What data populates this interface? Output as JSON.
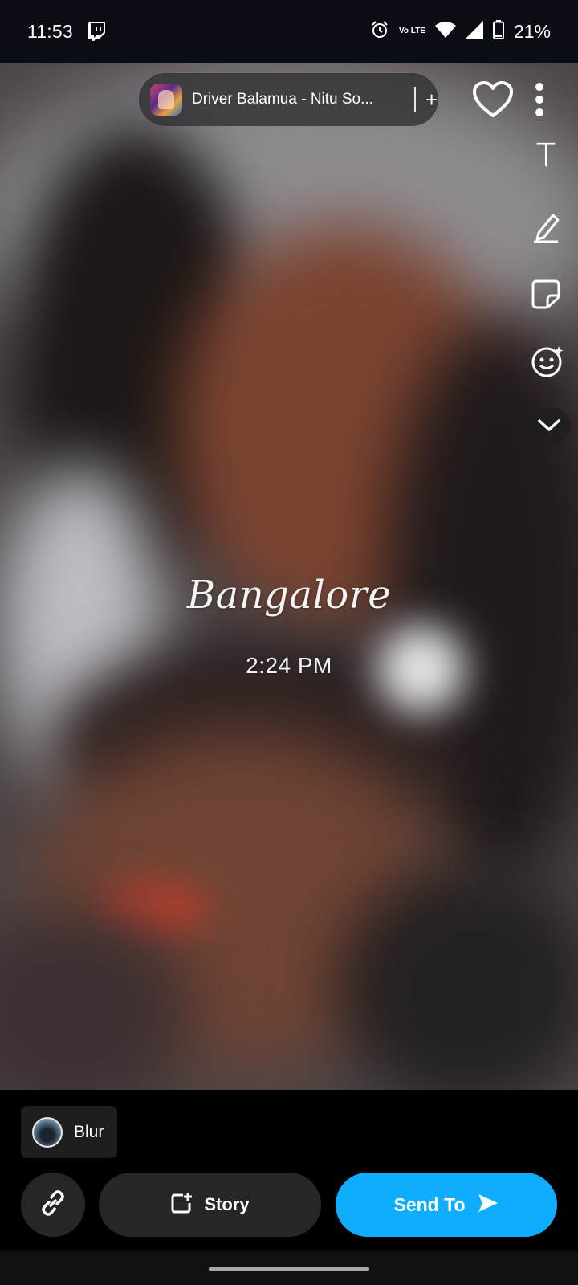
{
  "status_bar": {
    "time": "11:53",
    "network_label": "Vo LTE",
    "battery_percent": "21%"
  },
  "music": {
    "song_title": "Driver Balamua - Nitu So...",
    "add_symbol": "+"
  },
  "right_tools": {
    "text_tool": "T"
  },
  "caption": {
    "city": "Bangalore",
    "time": "2:24 PM"
  },
  "bottom": {
    "blur_label": "Blur",
    "story_label": "Story",
    "send_label": "Send To"
  },
  "colors": {
    "send_button": "#0fadff",
    "dark_button": "#262626",
    "status_bar_bg": "#0b0d15"
  }
}
